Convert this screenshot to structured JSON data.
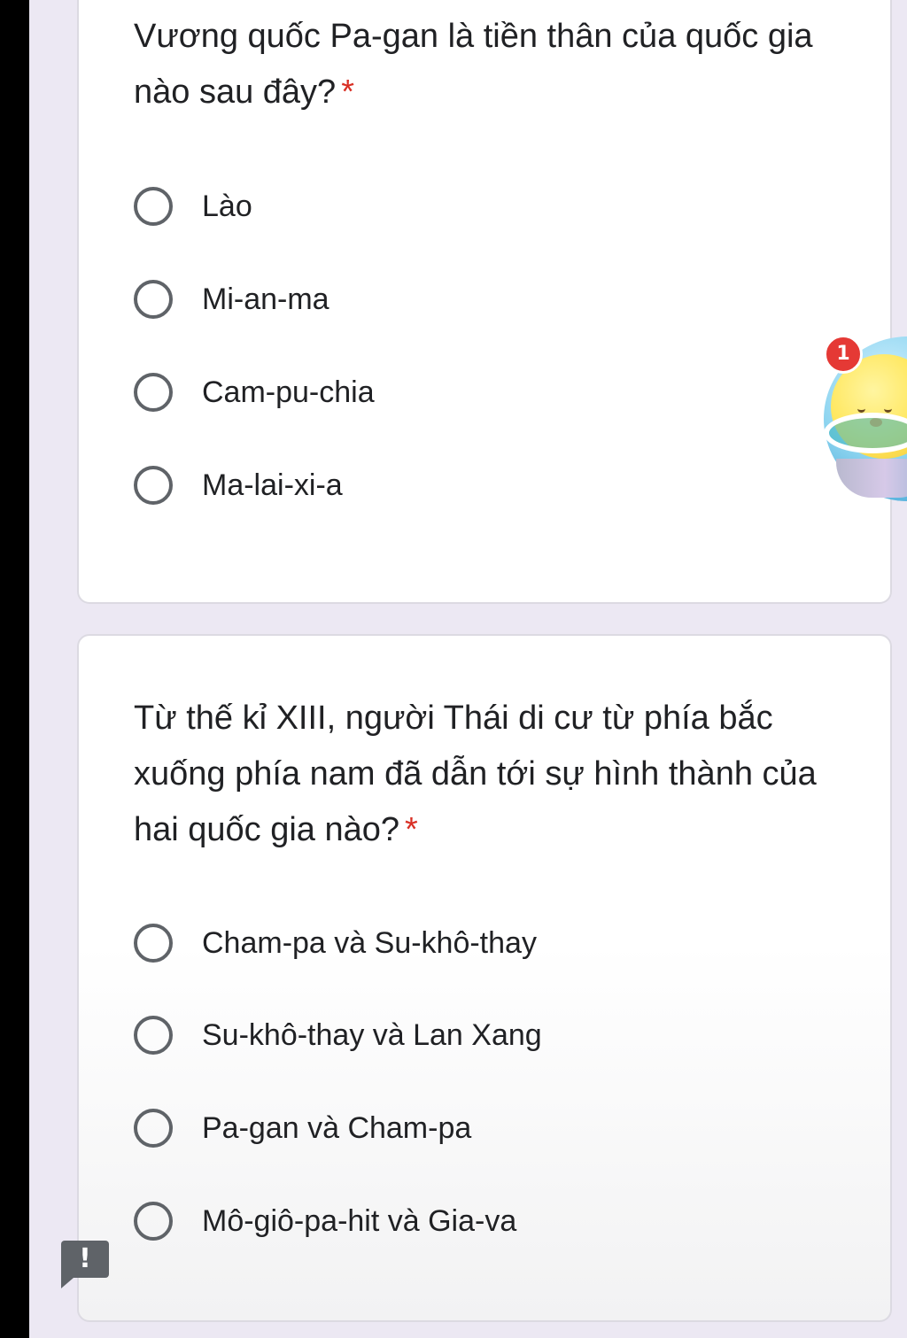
{
  "questions": [
    {
      "text": "Vương quốc Pa-gan là tiền thân của quốc gia nào sau đây?",
      "required_mark": "*",
      "options": [
        "Lào",
        "Mi-an-ma",
        "Cam-pu-chia",
        "Ma-lai-xi-a"
      ]
    },
    {
      "text": "Từ thế kỉ XIII, người Thái di cư từ phía bắc xuống phía nam đã dẫn tới sự hình thành của hai quốc gia nào?",
      "required_mark": "*",
      "options": [
        "Cham-pa và Su-khô-thay",
        "Su-khô-thay và Lan Xang",
        "Pa-gan và Cham-pa",
        "Mô-giô-pa-hit và Gia-va"
      ]
    }
  ],
  "floating_bubble": {
    "badge_count": "1",
    "icon": "chick-mascot-icon"
  },
  "report_button": {
    "icon": "exclamation-icon",
    "glyph": "!"
  },
  "colors": {
    "required": "#d93025",
    "radio_border": "#5f6368",
    "background": "#ece8f3",
    "badge": "#e53935"
  }
}
